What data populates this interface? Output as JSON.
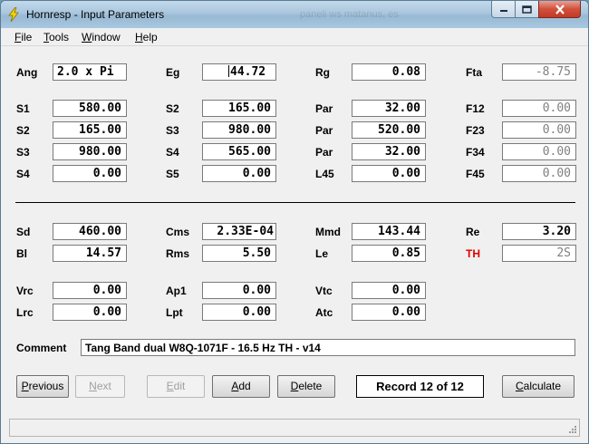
{
  "window": {
    "title": "Hornresp - Input Parameters",
    "ghost_title": "paneli ws matanus, es"
  },
  "menu": [
    "File",
    "Tools",
    "Window",
    "Help"
  ],
  "params": {
    "ang": {
      "label": "Ang",
      "value": "2.0 x Pi"
    },
    "eg": {
      "label": "Eg",
      "value": "44.72"
    },
    "rg": {
      "label": "Rg",
      "value": "0.08"
    },
    "fta": {
      "label": "Fta",
      "value": "-8.75"
    },
    "s1": {
      "label": "S1",
      "value": "580.00"
    },
    "s2_top": {
      "label": "S2",
      "value": "165.00"
    },
    "par1": {
      "label": "Par",
      "value": "32.00"
    },
    "f12": {
      "label": "F12",
      "value": "0.00"
    },
    "s2": {
      "label": "S2",
      "value": "165.00"
    },
    "s3_top": {
      "label": "S3",
      "value": "980.00"
    },
    "par2": {
      "label": "Par",
      "value": "520.00"
    },
    "f23": {
      "label": "F23",
      "value": "0.00"
    },
    "s3": {
      "label": "S3",
      "value": "980.00"
    },
    "s4_top": {
      "label": "S4",
      "value": "565.00"
    },
    "par3": {
      "label": "Par",
      "value": "32.00"
    },
    "f34": {
      "label": "F34",
      "value": "0.00"
    },
    "s4": {
      "label": "S4",
      "value": "0.00"
    },
    "s5": {
      "label": "S5",
      "value": "0.00"
    },
    "l45": {
      "label": "L45",
      "value": "0.00"
    },
    "f45": {
      "label": "F45",
      "value": "0.00"
    },
    "sd": {
      "label": "Sd",
      "value": "460.00"
    },
    "cms": {
      "label": "Cms",
      "value": "2.33E-04"
    },
    "mmd": {
      "label": "Mmd",
      "value": "143.44"
    },
    "re": {
      "label": "Re",
      "value": "3.20"
    },
    "bl": {
      "label": "Bl",
      "value": "14.57"
    },
    "rms": {
      "label": "Rms",
      "value": "5.50"
    },
    "le": {
      "label": "Le",
      "value": "0.85"
    },
    "th": {
      "label": "TH",
      "value": "2S"
    },
    "vrc": {
      "label": "Vrc",
      "value": "0.00"
    },
    "ap1": {
      "label": "Ap1",
      "value": "0.00"
    },
    "vtc": {
      "label": "Vtc",
      "value": "0.00"
    },
    "lrc": {
      "label": "Lrc",
      "value": "0.00"
    },
    "lpt": {
      "label": "Lpt",
      "value": "0.00"
    },
    "atc": {
      "label": "Atc",
      "value": "0.00"
    }
  },
  "comment": {
    "label": "Comment",
    "value": "Tang Band dual W8Q-1071F - 16.5 Hz TH - v14"
  },
  "buttons": {
    "previous": "Previous",
    "next": "Next",
    "edit": "Edit",
    "add": "Add",
    "delete": "Delete",
    "record": "Record 12 of 12",
    "calculate": "Calculate"
  },
  "colors": {
    "th_label": "#e00000",
    "titlebar": "#a9c6de",
    "close_button": "#c23a25"
  }
}
